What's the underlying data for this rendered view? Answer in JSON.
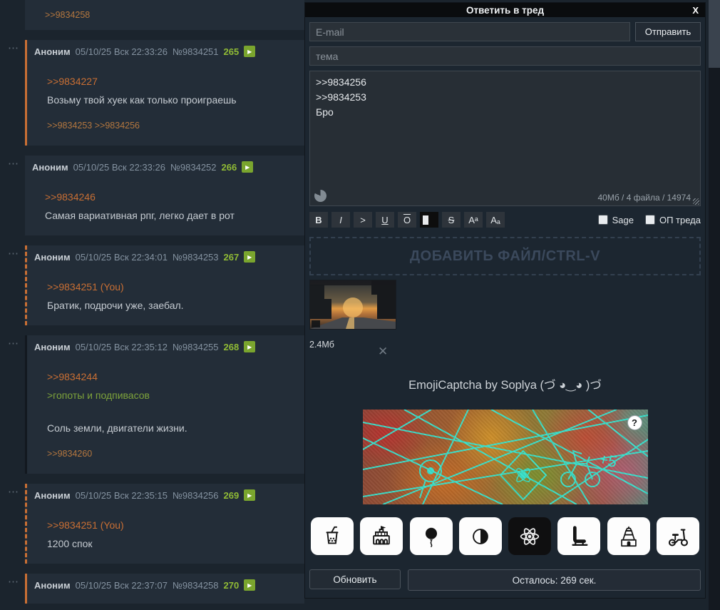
{
  "icons": {
    "post_menu": "⋯",
    "play": "▶",
    "close": "X",
    "remove_file": "✕",
    "help": "?"
  },
  "thread": {
    "fragment": {
      "replies": ">>9834258"
    },
    "posts": [
      {
        "name": "Аноним",
        "date": "05/10/25 Вск 22:33:26",
        "number": "№9834251",
        "index": "265",
        "quote": ">>9834227",
        "text": "Возьму твой хуек как только проиграешь",
        "replies": ">>9834253 >>9834256"
      },
      {
        "name": "Аноним",
        "date": "05/10/25 Вск 22:33:26",
        "number": "№9834252",
        "index": "266",
        "quote": ">>9834246",
        "text": "Самая вариативная рпг, легко дает в рот"
      },
      {
        "name": "Аноним",
        "date": "05/10/25 Вск 22:34:01",
        "number": "№9834253",
        "index": "267",
        "quote": ">>9834251 (You)",
        "text": "Братик, подрочи уже, заебал."
      },
      {
        "name": "Аноним",
        "date": "05/10/25 Вск 22:35:12",
        "number": "№9834255",
        "index": "268",
        "quote": ">>9834244",
        "greentext": ">гопоты и подпивасов",
        "text": "Соль земли, двигатели жизни.",
        "replies": ">>9834260"
      },
      {
        "name": "Аноним",
        "date": "05/10/25 Вск 22:35:15",
        "number": "№9834256",
        "index": "269",
        "quote": ">>9834251 (You)",
        "text": "1200 спок"
      },
      {
        "name": "Аноним",
        "date": "05/10/25 Вск 22:37:07",
        "number": "№9834258",
        "index": "270"
      }
    ]
  },
  "form": {
    "title": "Ответить в тред",
    "email_placeholder": "E-mail",
    "submit_label": "Отправить",
    "subject_placeholder": "тема",
    "comment": ">>9834256\n>>9834253\nБро",
    "limits": "40Мб / 4 файла / 14974",
    "toolbar": {
      "bold": "B",
      "italic": "I",
      "quote": ">",
      "underline": "U",
      "overline": "O",
      "strike": "S",
      "sup": "Aᵃ",
      "sub": "Aₐ"
    },
    "sage_label": "Sage",
    "op_label": "ОП треда",
    "dropzone_label": "ДОБАВИТЬ ФАЙЛ/CTRL-V",
    "file": {
      "size": "2.4Мб"
    },
    "captcha": {
      "title": "EmojiCaptcha by Soplya (づ ◕‿◕ )づ",
      "options": [
        "bubble-tea",
        "stadium",
        "balloon",
        "half-moon",
        "atom",
        "armchair",
        "temple",
        "scooter"
      ],
      "refresh_label": "Обновить",
      "remaining": "Осталось: 269 сек."
    }
  },
  "colors": {
    "accent_orange": "#c96f34",
    "accent_green": "#90bb35",
    "captcha_cyan": "#35e6d2"
  }
}
